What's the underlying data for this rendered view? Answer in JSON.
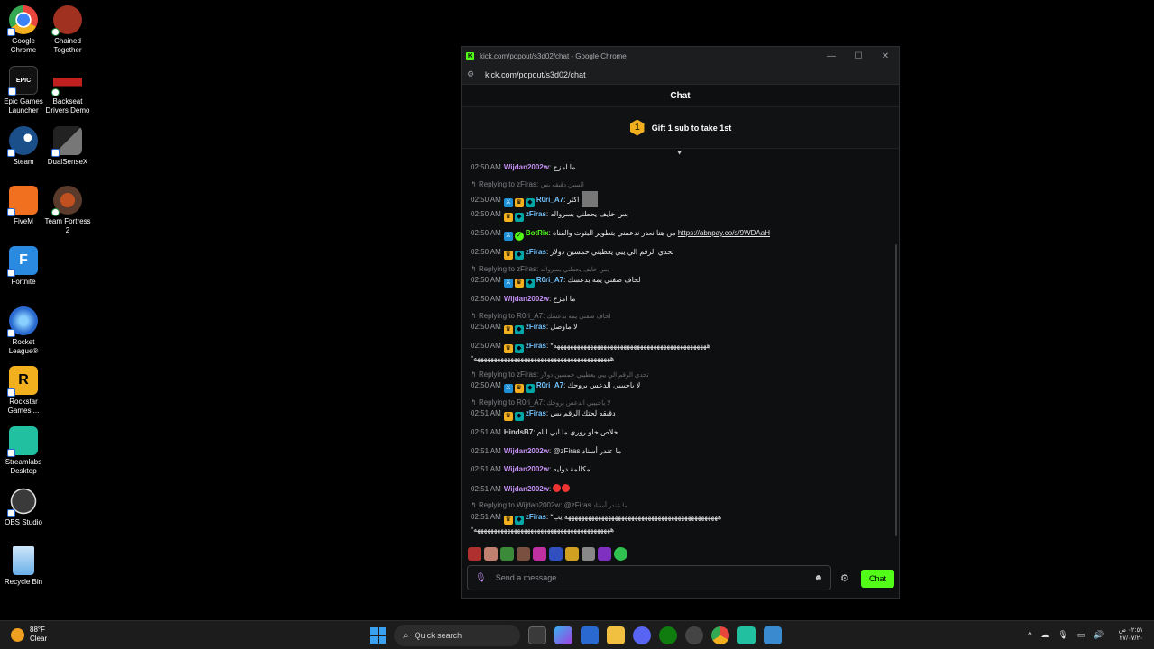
{
  "desktop": {
    "icons": [
      {
        "label": "Google Chrome",
        "color": "#e8453c"
      },
      {
        "label": "Chained Together",
        "color": "#a03020"
      },
      {
        "label": "Epic Games Launcher",
        "color": "#222222"
      },
      {
        "label": "Backseat Drivers Demo",
        "color": "#c02020"
      },
      {
        "label": "Steam",
        "color": "#1b4f8a"
      },
      {
        "label": "DualSenseX",
        "color": "#444444"
      },
      {
        "label": "FiveM",
        "color": "#f07020"
      },
      {
        "label": "Team Fortress 2",
        "color": "#6a4a3a"
      },
      {
        "label": "Fortnite",
        "color": "#2a8ae0"
      },
      {
        "label": "Rocket League®",
        "color": "#2a6ad0"
      },
      {
        "label": "Rockstar Games ...",
        "color": "#f2b01e"
      },
      {
        "label": "Streamlabs Desktop",
        "color": "#20c0a0"
      },
      {
        "label": "OBS Studio",
        "color": "#3a3a3a"
      },
      {
        "label": "Recycle Bin",
        "color": "#3a8ad0"
      }
    ]
  },
  "window": {
    "title": "kick.com/popout/s3d02/chat - Google Chrome",
    "url": "kick.com/popout/s3d02/chat",
    "chat_title": "Chat",
    "gift_count": "1",
    "gift_text": "Gift 1 sub to take 1st"
  },
  "messages": {
    "m1": {
      "time": "02:50 AM",
      "user": "Wijdan2002w",
      "text": "ما امزح"
    },
    "r2": {
      "label": "Replying to zFiras:",
      "quote": "السين دقيقه بس"
    },
    "m2": {
      "time": "02:50 AM",
      "user": "R0ri_A7",
      "text": "اكثر"
    },
    "m3": {
      "time": "02:50 AM",
      "user": "zFiras",
      "text": "بس خايف يحطني بسرواله"
    },
    "m4": {
      "time": "02:50 AM",
      "user": "BotRix",
      "text": "من هنا نعدر ندعمني بتطوير البثوث والفناة",
      "link": "https://abnpay.co/s/9WDAaH"
    },
    "m5": {
      "time": "02:50 AM",
      "user": "zFiras",
      "text": "تحدي الرقم الي يبي يعطيني خمسين دولار"
    },
    "r6": {
      "label": "Replying to zFiras:",
      "quote": "بس خايف يحطني بسرواله"
    },
    "m6": {
      "time": "02:50 AM",
      "user": "R0ri_A7",
      "text": "لحاف صفني يمه بدعسك"
    },
    "m7": {
      "time": "02:50 AM",
      "user": "Wijdan2002w",
      "text": "ما امزح"
    },
    "r8": {
      "label": "Replying to R0ri_A7:",
      "quote": "لحاف صفني يمه بدعسك"
    },
    "m8": {
      "time": "02:50 AM",
      "user": "zFiras",
      "text": "لا ماوصل"
    },
    "m9": {
      "time": "02:50 AM",
      "user": "zFiras",
      "text": "*ههههههههههههههههههههههههههههههههههههههههههههههه",
      "cont": "*هههههههههههههههههههههههههههههههههههههههههه"
    },
    "r10": {
      "label": "Replying to zFiras:",
      "quote": "تحدي الرقم الي يبي يعطيني خمسين دولار"
    },
    "m10": {
      "time": "02:50 AM",
      "user": "R0ri_A7",
      "text": "لا ياحبيبي الدعس بروحك"
    },
    "r11": {
      "label": "Replying to R0ri_A7:",
      "quote": "لا ياحبيبي الدعس بروحك"
    },
    "m11": {
      "time": "02:51 AM",
      "user": "zFiras",
      "text": "دقيقه لحتك الرقم بس"
    },
    "m12": {
      "time": "02:51 AM",
      "user": "HindsB7",
      "text": "خلاص خلو روري ما ابي انام"
    },
    "m13": {
      "time": "02:51 AM",
      "user": "Wijdan2002w",
      "text": "@zFiras ما عندر أسناد"
    },
    "m14": {
      "time": "02:51 AM",
      "user": "Wijdan2002w",
      "text": "مكالمة دوليه"
    },
    "m15": {
      "time": "02:51 AM",
      "user": "Wijdan2002w"
    },
    "r16": {
      "label": "Replying to Wijdan2002w: @zFiras",
      "quote": "ما عندر أسناد"
    },
    "m16": {
      "time": "02:51 AM",
      "user": "zFiras",
      "text": "*ههههههههههههههههههههههههههههههههههههههههههههههه يب",
      "cont": "*هههههههههههههههههههههههههههههههههههههههههه"
    }
  },
  "composer": {
    "placeholder": "Send a message",
    "send_label": "Chat"
  },
  "taskbar": {
    "temp": "88°F",
    "condition": "Clear",
    "search_label": "Quick search",
    "time": "٠٢:٥١ ص",
    "date": "٢٧/٠٧/٢٠"
  }
}
